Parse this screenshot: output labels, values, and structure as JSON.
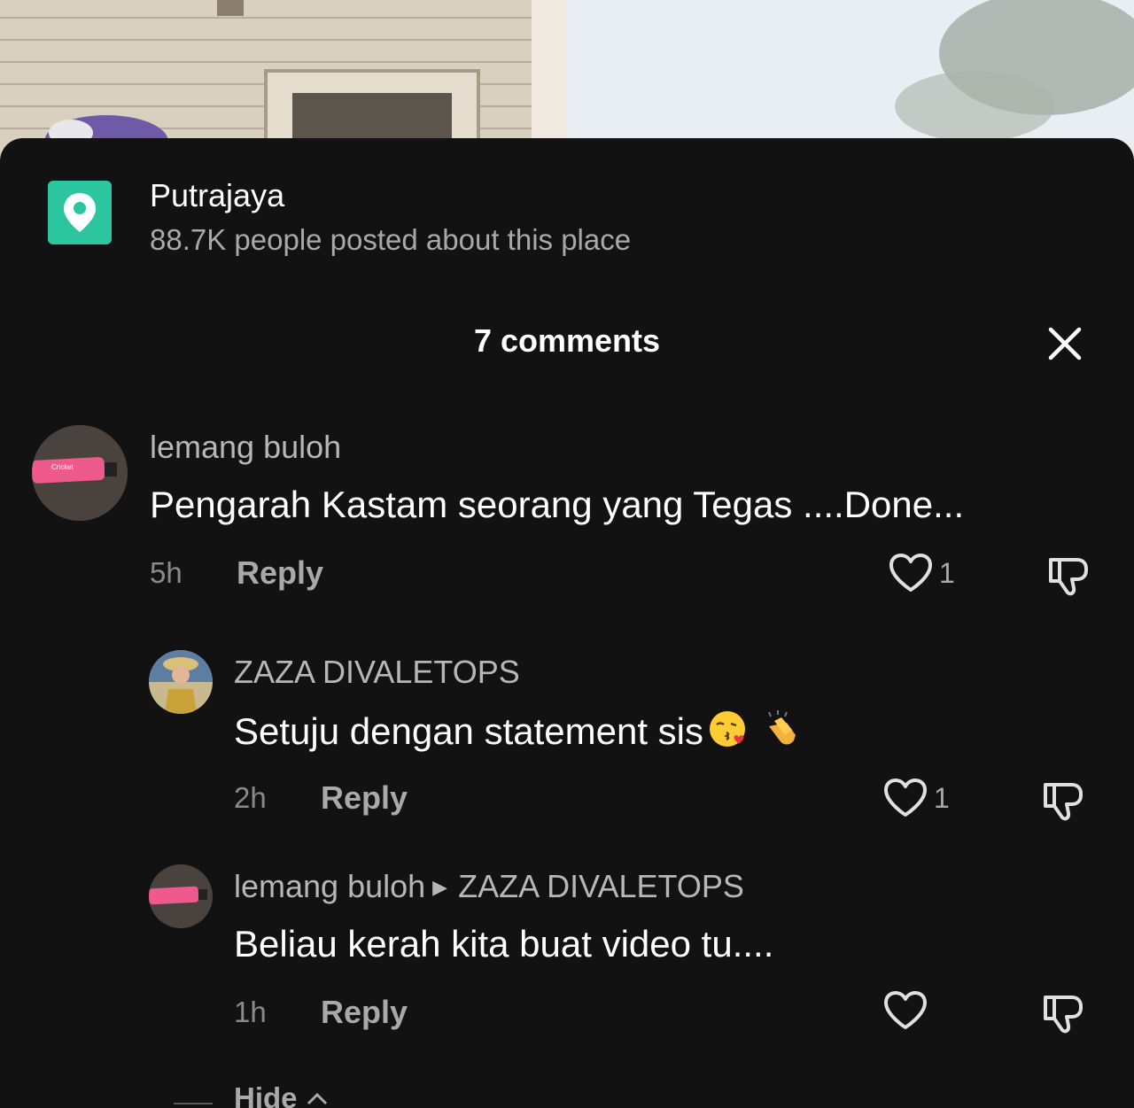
{
  "location": {
    "name": "Putrajaya",
    "subtitle": "88.7K people posted about this place",
    "icon": "location-pin-icon",
    "icon_color": "#2bc6a0"
  },
  "header": {
    "title": "7 comments",
    "close_icon": "close-icon"
  },
  "comments": [
    {
      "username": "lemang buloh",
      "text": "Pengarah Kastam seorang yang Tegas ....Done...",
      "time": "5h",
      "reply_label": "Reply",
      "likes": "1"
    },
    {
      "username": "ZAZA DIVALETOPS",
      "text": "Setuju dengan statement sis",
      "emojis": [
        "kissing-heart-emoji",
        "clapping-hands-emoji"
      ],
      "time": "2h",
      "reply_label": "Reply",
      "likes": "1"
    },
    {
      "username": "lemang buloh",
      "reply_to": "ZAZA DIVALETOPS",
      "text": "Beliau kerah kita buat video tu....",
      "time": "1h",
      "reply_label": "Reply",
      "likes": ""
    }
  ],
  "hide_label": "Hide",
  "colors": {
    "background": "#121212",
    "accent": "#2bc6a0"
  }
}
